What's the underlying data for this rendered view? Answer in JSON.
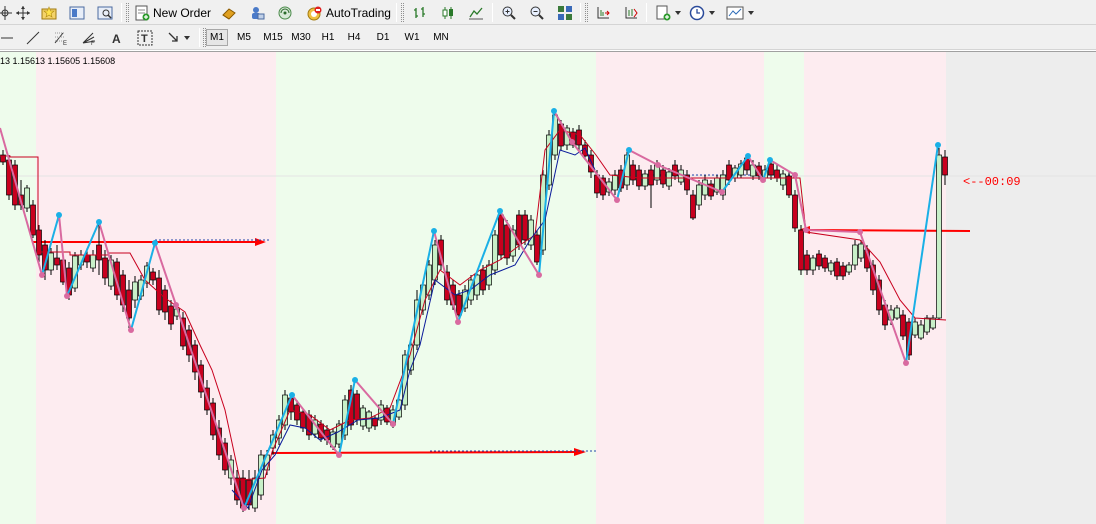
{
  "toolbar": {
    "new_order_label": "New Order",
    "autotrading_label": "AutoTrading"
  },
  "timeframes": [
    "M1",
    "M5",
    "M15",
    "M30",
    "H1",
    "H4",
    "D1",
    "W1",
    "MN"
  ],
  "active_timeframe": "M1",
  "chart": {
    "price_info": "13 1.15613 1.15605 1.15608",
    "timer_label": "<--00:09"
  },
  "colors": {
    "bull_candle": "#c8f0c8",
    "bear_candle": "#c8001e",
    "zigzag_high": "#1ab0e6",
    "zigzag_low": "#d96aa0",
    "trail_red": "#c8001e",
    "trail_blue": "#0a1a9a",
    "zone_pink": "#fdecf0",
    "zone_green": "#eefcec",
    "zone_gray": "#ededed",
    "arrow_red": "#ff0000"
  },
  "icons": {
    "row1": [
      "crosshair-icon",
      "favorites-icon",
      "navigator-icon",
      "data-window-icon",
      "new-order-icon",
      "market-watch-icon",
      "terminal-icon",
      "signals-icon",
      "autotrading-icon",
      "bar-chart-icon",
      "candlestick-icon",
      "line-chart-icon",
      "zoom-in-icon",
      "zoom-out-icon",
      "tile-windows-icon",
      "chart-shift-icon",
      "autoscroll-icon",
      "indicators-icon",
      "periodicity-icon",
      "templates-icon"
    ],
    "row2": [
      "horizontal-line-icon",
      "trendline-icon",
      "fibonacci-icon",
      "fibonacci-fan-icon",
      "text-icon",
      "text-label-icon",
      "arrows-icon"
    ]
  }
}
